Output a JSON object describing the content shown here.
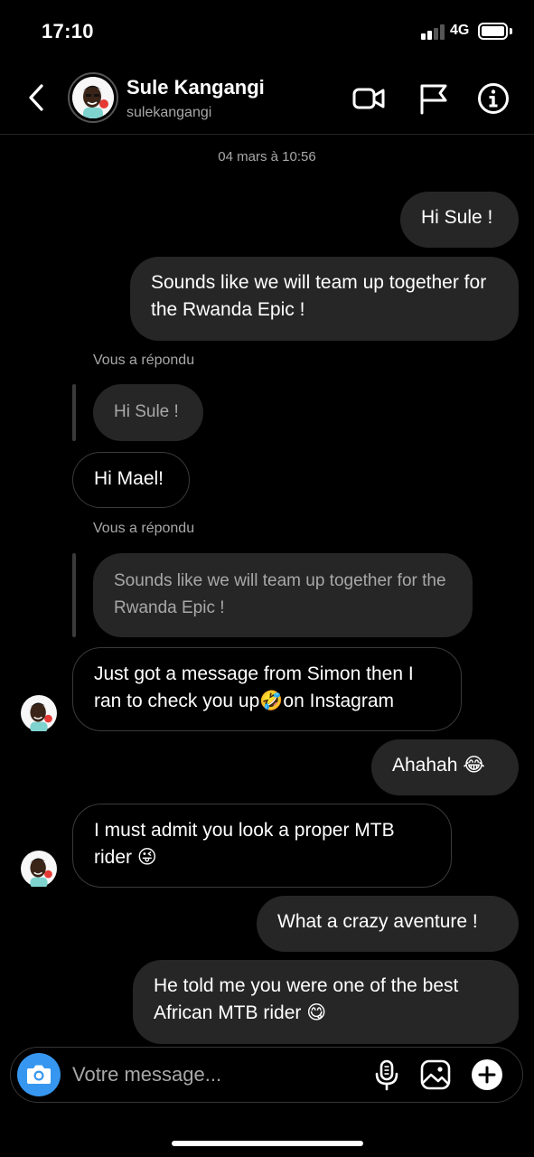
{
  "status_bar": {
    "time": "17:10",
    "network": "4G"
  },
  "header": {
    "name": "Sule Kangangi",
    "username": "sulekangangi"
  },
  "thread": {
    "timestamp": "04 mars à 10:56",
    "reply_label": "Vous a répondu",
    "messages": [
      {
        "text": "Hi Sule !"
      },
      {
        "text": "Sounds like we will team up together for the Rwanda Epic !"
      },
      {
        "text": "Hi Sule !"
      },
      {
        "text": "Hi Mael!"
      },
      {
        "text": "Sounds like we will team up together for the Rwanda Epic !"
      },
      {
        "text": "Just got a message from Simon then I ran to check you up🤣on Instagram"
      },
      {
        "text": "Ahahah 😂"
      },
      {
        "text": "I must admit you look a proper MTB rider 😜"
      },
      {
        "text": "What a crazy aventure !"
      },
      {
        "text": "He told me you were one of the best African MTB rider 😋"
      }
    ]
  },
  "composer": {
    "placeholder": "Votre message..."
  }
}
